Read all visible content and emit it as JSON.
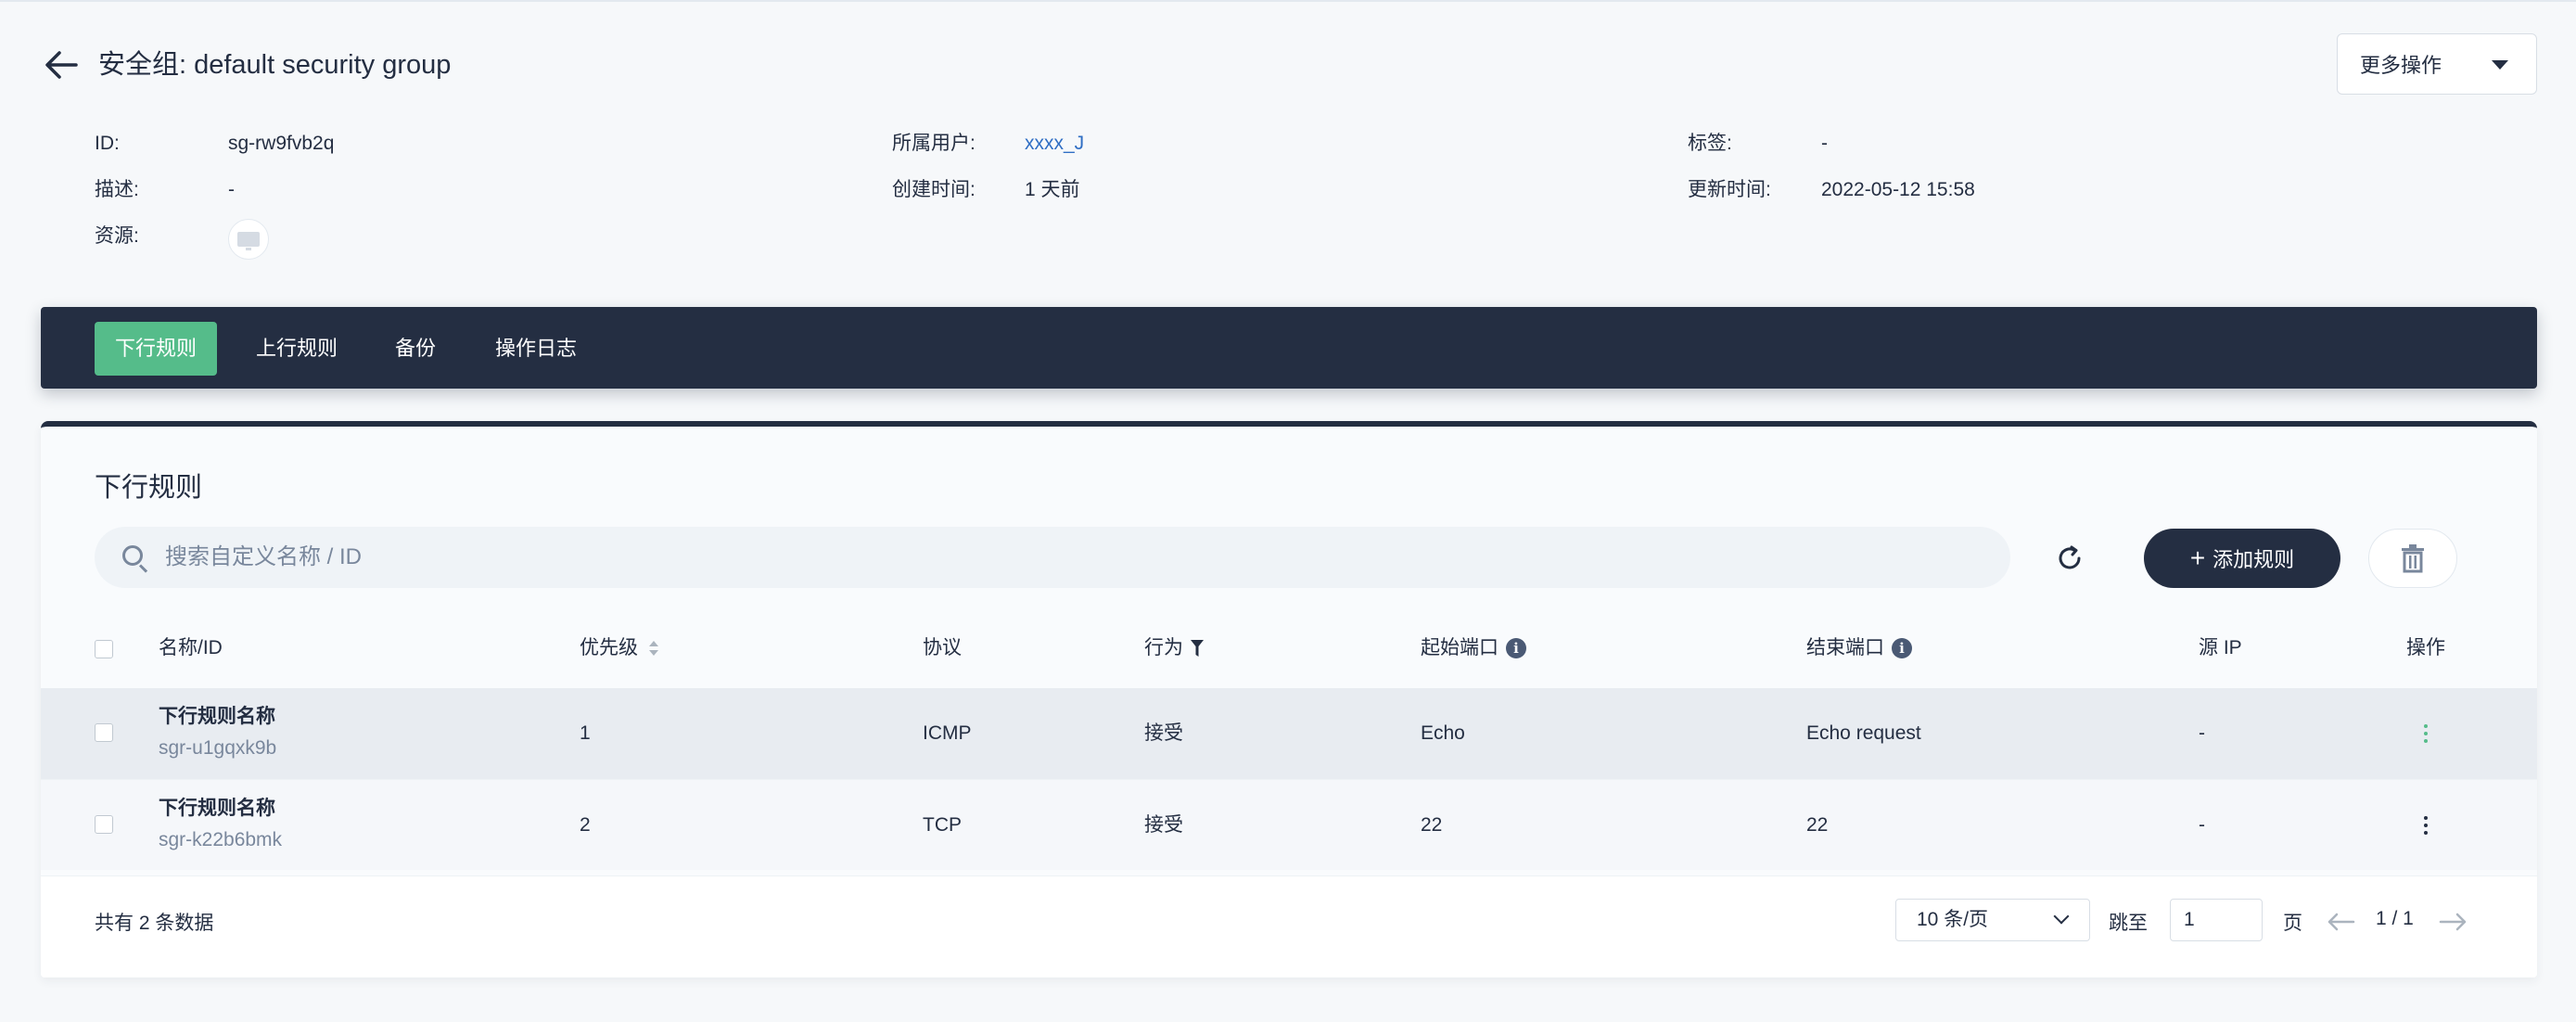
{
  "header": {
    "title": "安全组:  default security group",
    "more_actions": "更多操作"
  },
  "meta": {
    "id_label": "ID:",
    "id_value": "sg-rw9fvb2q",
    "desc_label": "描述:",
    "desc_value": "-",
    "resource_label": "资源:",
    "owner_label": "所属用户:",
    "owner_value": "xxxx_J",
    "created_label": "创建时间:",
    "created_value": "1 天前",
    "tags_label": "标签:",
    "tags_value": "-",
    "updated_label": "更新时间:",
    "updated_value": "2022-05-12 15:58"
  },
  "tabs": [
    "下行规则",
    "上行规则",
    "备份",
    "操作日志"
  ],
  "active_tab": "下行规则",
  "panel": {
    "title": "下行规则",
    "search_placeholder": "搜索自定义名称 / ID",
    "add_button": "添加规则"
  },
  "table": {
    "columns": [
      "名称/ID",
      "优先级",
      "协议",
      "行为",
      "起始端口",
      "结束端口",
      "源 IP",
      "操作"
    ],
    "rows": [
      {
        "name": "下行规则名称",
        "id": "sgr-u1gqxk9b",
        "priority": "1",
        "protocol": "ICMP",
        "action": "接受",
        "start_port": "Echo",
        "end_port": "Echo request",
        "source_ip": "-"
      },
      {
        "name": "下行规则名称",
        "id": "sgr-k22b6bmk",
        "priority": "2",
        "protocol": "TCP",
        "action": "接受",
        "start_port": "22",
        "end_port": "22",
        "source_ip": "-"
      }
    ]
  },
  "footer": {
    "total": "共有 2 条数据",
    "page_size": "10 条/页",
    "jump_label": "跳至",
    "jump_value": "1",
    "page_unit": "页",
    "page_indicator": "1 / 1"
  },
  "colors": {
    "accent_green": "#55bc8a",
    "dark": "#242e42",
    "link_blue": "#2f6ec4"
  }
}
